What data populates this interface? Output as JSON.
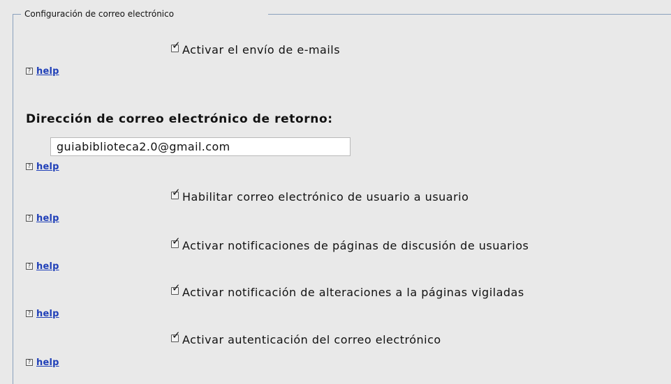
{
  "fieldset": {
    "legend": "Configuración de correo electrónico"
  },
  "help_icon_glyph": "?",
  "options": [
    {
      "label": "Activar el envío de e-mails",
      "checked": true,
      "help": "help"
    },
    {
      "label": "Habilitar correo electrónico de usuario a usuario",
      "checked": true,
      "help": "help"
    },
    {
      "label": "Activar notificaciones de páginas de discusión de usuarios",
      "checked": true,
      "help": "help"
    },
    {
      "label": "Activar notificación de alteraciones a la páginas vigiladas",
      "checked": true,
      "help": "help"
    },
    {
      "label": "Activar autenticación del correo electrónico",
      "checked": true,
      "help": "help"
    }
  ],
  "return_address": {
    "label": "Dirección de correo electrónico de retorno:",
    "value": "guiabiblioteca2.0@gmail.com",
    "help": "help"
  },
  "colors": {
    "background": "#e9e9e9",
    "link": "#1f3fb8",
    "fieldset_border": "#8aa0bd"
  }
}
